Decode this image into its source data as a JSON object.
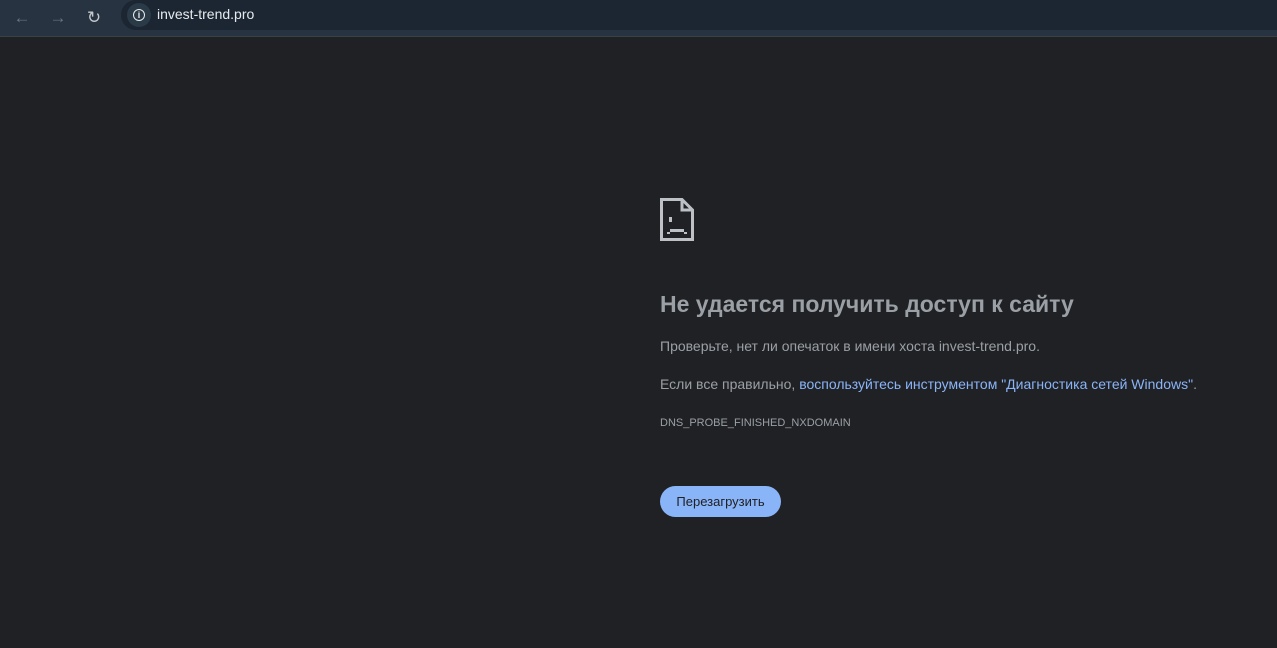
{
  "browser": {
    "url": "invest-trend.pro",
    "icons": {
      "back": "arrow-left",
      "forward": "arrow-right",
      "reload": "reload",
      "info": "info-circle"
    }
  },
  "error": {
    "icon": "sad-document",
    "title": "Не удается получить доступ к сайту",
    "check_text": "Проверьте, нет ли опечаток в имени хоста invest-trend.pro.",
    "correct_prefix": "Если все правильно, ",
    "diagnostics_link": "воспользуйтесь инструментом \"Диагностика сетей Windows\"",
    "correct_suffix": ".",
    "error_code": "DNS_PROBE_FINISHED_NXDOMAIN",
    "reload_button": "Перезагрузить"
  },
  "colors": {
    "background": "#202124",
    "accent": "#8ab4f8",
    "text": "#9aa0a6"
  }
}
